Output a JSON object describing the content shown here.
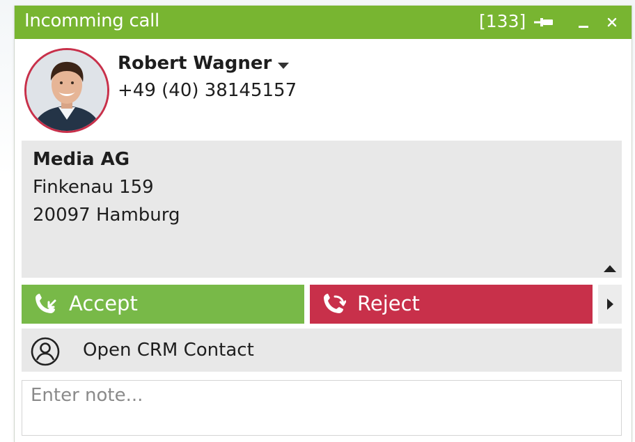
{
  "window": {
    "title": "Incomming call",
    "extension": "[133]"
  },
  "contact": {
    "name": "Robert Wagner",
    "phone": "+49 (40) 38145157"
  },
  "address": {
    "company": "Media AG",
    "street": "Finkenau 159",
    "city": "20097 Hamburg"
  },
  "actions": {
    "accept_label": "Accept",
    "reject_label": "Reject",
    "crm_label": "Open CRM Contact"
  },
  "note": {
    "placeholder": "Enter note..."
  },
  "icons": {
    "pin": "pin-icon",
    "minimize": "minimize-icon",
    "close": "close-icon",
    "dropdown": "caret-down-icon",
    "collapse": "caret-up-icon",
    "accept": "phone-incoming-icon",
    "reject": "phone-reject-icon",
    "more": "caret-right-icon",
    "crm": "user-circle-icon"
  },
  "colors": {
    "titlebar": "#78b531",
    "accept": "#78b948",
    "reject": "#c8304a",
    "panel": "#e8e8e8"
  }
}
